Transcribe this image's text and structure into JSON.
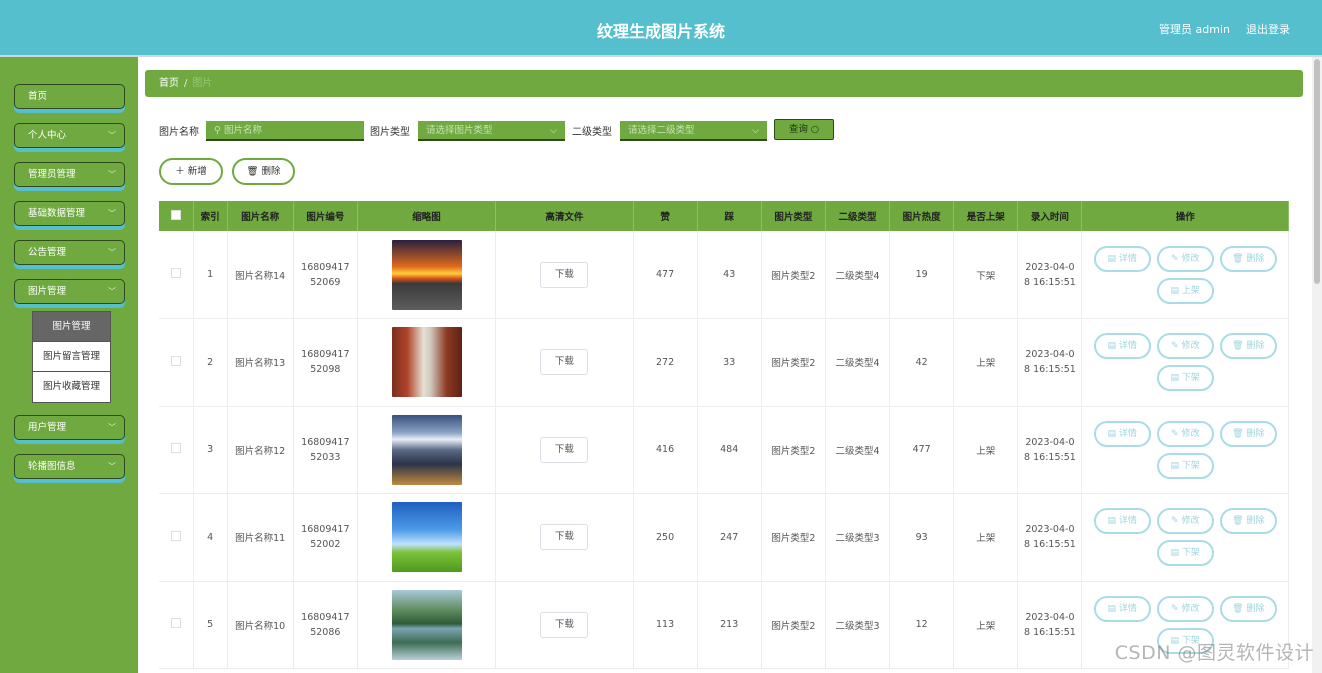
{
  "header": {
    "title": "纹理生成图片系统",
    "user": "管理员 admin",
    "logout": "退出登录"
  },
  "sidebar": {
    "items": [
      {
        "label": "首页",
        "has_arrow": false
      },
      {
        "label": "个人中心",
        "has_arrow": true
      },
      {
        "label": "管理员管理",
        "has_arrow": true
      },
      {
        "label": "基础数据管理",
        "has_arrow": true
      },
      {
        "label": "公告管理",
        "has_arrow": true
      },
      {
        "label": "图片管理",
        "has_arrow": true
      },
      {
        "label": "用户管理",
        "has_arrow": true
      },
      {
        "label": "轮播图信息",
        "has_arrow": true
      }
    ],
    "submenu": [
      "图片管理",
      "图片留言管理",
      "图片收藏管理"
    ]
  },
  "breadcrumb": {
    "home": "首页",
    "separator": "/",
    "current": "图片"
  },
  "filters": {
    "name_label": "图片名称",
    "name_placeholder": "图片名称",
    "type_label": "图片类型",
    "type_placeholder": "请选择图片类型",
    "subtype_label": "二级类型",
    "subtype_placeholder": "请选择二级类型",
    "search_button": "查询"
  },
  "actions": {
    "add": "新增",
    "delete": "删除"
  },
  "table": {
    "headers": [
      "索引",
      "图片名称",
      "图片编号",
      "缩略图",
      "高清文件",
      "赞",
      "踩",
      "图片类型",
      "二级类型",
      "图片热度",
      "是否上架",
      "录入时间",
      "操作"
    ],
    "download_label": "下载",
    "op_labels": {
      "detail": "详情",
      "edit": "修改",
      "delete": "删除",
      "up": "上架",
      "down": "下架"
    },
    "rows": [
      {
        "index": "1",
        "name": "图片名称14",
        "code1": "16809417",
        "code2": "52069",
        "likes": "477",
        "dislikes": "43",
        "type": "图片类型2",
        "subtype": "二级类型4",
        "heat": "19",
        "status": "下架",
        "time1": "2023-04-0",
        "time2": "8 16:15:51",
        "toggle": "上架",
        "thumb": "sunset-road"
      },
      {
        "index": "2",
        "name": "图片名称13",
        "code1": "16809417",
        "code2": "52098",
        "likes": "272",
        "dislikes": "33",
        "type": "图片类型2",
        "subtype": "二级类型4",
        "heat": "42",
        "status": "上架",
        "time1": "2023-04-0",
        "time2": "8 16:15:51",
        "toggle": "下架",
        "thumb": "corridor"
      },
      {
        "index": "3",
        "name": "图片名称12",
        "code1": "16809417",
        "code2": "52033",
        "likes": "416",
        "dislikes": "484",
        "type": "图片类型2",
        "subtype": "二级类型4",
        "heat": "477",
        "status": "上架",
        "time1": "2023-04-0",
        "time2": "8 16:15:51",
        "toggle": "下架",
        "thumb": "mountain-city"
      },
      {
        "index": "4",
        "name": "图片名称11",
        "code1": "16809417",
        "code2": "52002",
        "likes": "250",
        "dislikes": "247",
        "type": "图片类型2",
        "subtype": "二级类型3",
        "heat": "93",
        "status": "上架",
        "time1": "2023-04-0",
        "time2": "8 16:15:51",
        "toggle": "下架",
        "thumb": "sky-grass"
      },
      {
        "index": "5",
        "name": "图片名称10",
        "code1": "16809417",
        "code2": "52086",
        "likes": "113",
        "dislikes": "213",
        "type": "图片类型2",
        "subtype": "二级类型3",
        "heat": "12",
        "status": "上架",
        "time1": "2023-04-0",
        "time2": "8 16:15:51",
        "toggle": "下架",
        "thumb": "lake-mountains"
      }
    ]
  },
  "watermark": "CSDN @图灵软件设计",
  "colors": {
    "header": "#55bfcd",
    "sidebar": "#6fa93f",
    "accent_dark": "#2f4a1c",
    "op_button": "#a9dce4"
  }
}
